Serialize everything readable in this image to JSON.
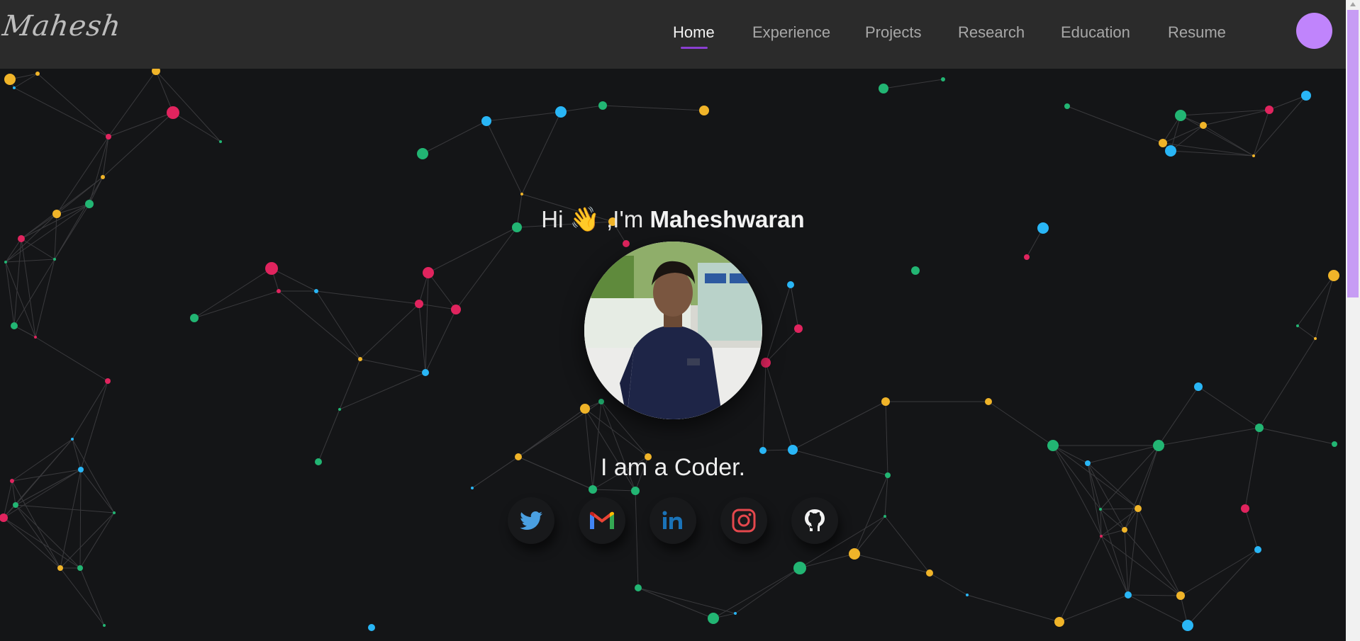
{
  "header": {
    "logo_text": "Mahesh",
    "nav": [
      {
        "label": "Home",
        "active": true
      },
      {
        "label": "Experience",
        "active": false
      },
      {
        "label": "Projects",
        "active": false
      },
      {
        "label": "Research",
        "active": false
      },
      {
        "label": "Education",
        "active": false
      },
      {
        "label": "Resume",
        "active": false
      }
    ],
    "theme_toggle": {
      "icon": "night-landscape-toggle",
      "knob_color": "#c084fc"
    }
  },
  "hero": {
    "greeting_prefix": "Hi",
    "wave_emoji": "👋",
    "greeting_mid": ",I'm",
    "name": "Maheshwaran",
    "avatar": "profile-photo",
    "tagline": "I am a Coder."
  },
  "social_links": [
    {
      "name": "twitter-icon",
      "color": "#1d9bf0"
    },
    {
      "name": "gmail-icon",
      "color": "#ea4335"
    },
    {
      "name": "linkedin-icon",
      "color": "#0a66c2"
    },
    {
      "name": "instagram-icon",
      "color": "#e1306c"
    },
    {
      "name": "github-icon",
      "color": "#ffffff"
    }
  ],
  "colors": {
    "navbar_bg": "#2b2b2b",
    "page_bg": "#141517",
    "accent": "#8a3fd1",
    "particle_colors": [
      "#f0b429",
      "#e0245e",
      "#22b573",
      "#29b6f6"
    ]
  }
}
